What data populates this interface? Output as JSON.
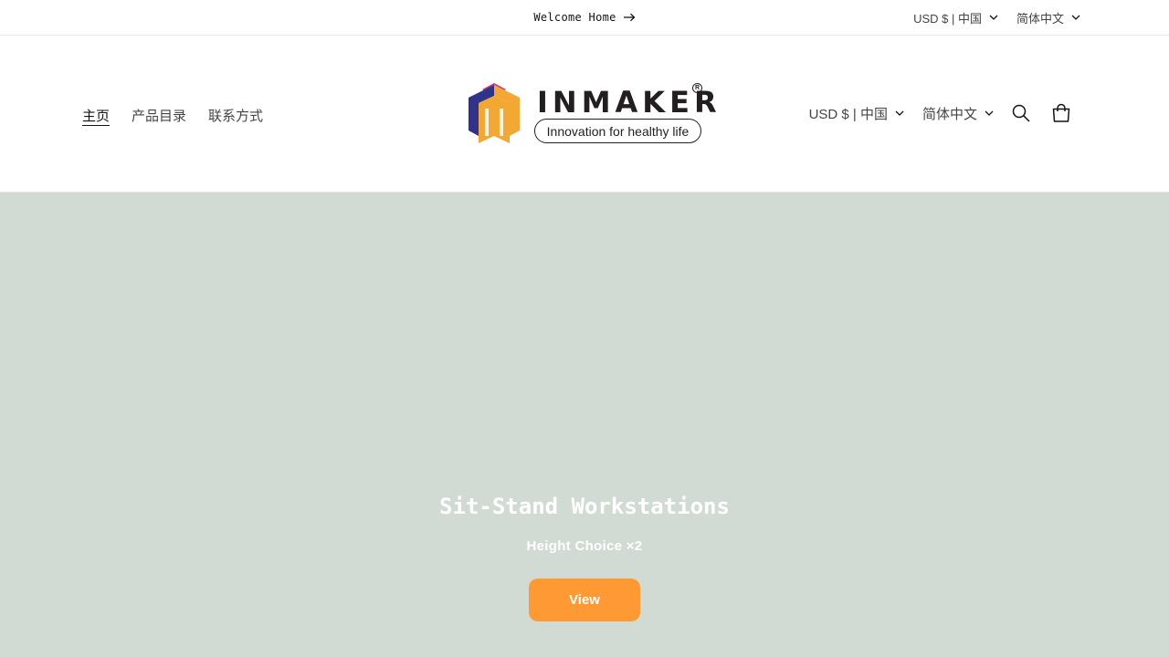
{
  "announcement": {
    "text": "Welcome Home",
    "arrow_icon": "arrow-right-icon"
  },
  "top_selectors": {
    "currency": "USD $ | 中国",
    "language": "简体中文"
  },
  "nav": {
    "items": [
      {
        "label": "主页",
        "active": true
      },
      {
        "label": "产品目录",
        "active": false
      },
      {
        "label": "联系方式",
        "active": false
      }
    ]
  },
  "logo": {
    "brand": "INMAKER",
    "registered": "R",
    "tagline": "Innovation for healthy life"
  },
  "header_selectors": {
    "currency": "USD $ | 中国",
    "language": "简体中文",
    "search_icon": "search-icon",
    "cart_icon": "cart-icon"
  },
  "hero": {
    "title": "Sit-Stand Workstations",
    "subtitle": "Height Choice ×2",
    "button_label": "View",
    "background_color": "#d1dbd4",
    "button_color": "#ff9933"
  }
}
